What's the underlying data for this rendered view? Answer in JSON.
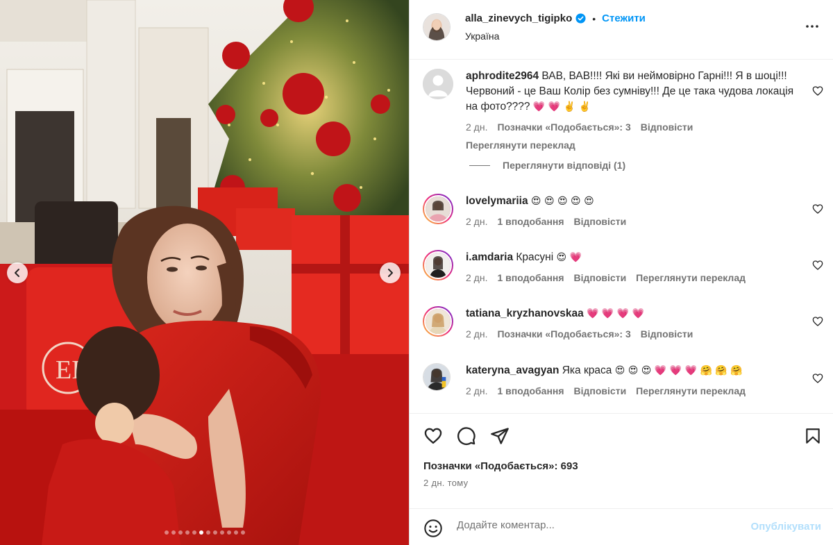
{
  "post": {
    "username": "alla_zinevych_tigipko",
    "follow_label": "Стежити",
    "separator": "•",
    "location": "Україна",
    "more_label": "•••"
  },
  "carousel": {
    "dots_total": 12,
    "active_dot_index": 5
  },
  "comments": [
    {
      "username": "aphrodite2964",
      "text": "ВАВ, ВАВ!!!! Які ви неймовірно Гарні!!! Я в шоці!!! Червоний - це Ваш Колір без сумніву!!! Де це така чудова локація на фото????",
      "emojis": "💗 💗 ✌️ ✌️",
      "time": "2 дн.",
      "likes": "Позначки «Подобається»: 3",
      "reply": "Відповісти",
      "translate": "Переглянути переклад",
      "view_replies": "Переглянути відповіді (1)"
    },
    {
      "username": "lovelymariia",
      "text": "",
      "emojis": "😍 😍 😍 😍 😍",
      "time": "2 дн.",
      "likes": "1 вподобання",
      "reply": "Відповісти",
      "translate": ""
    },
    {
      "username": "i.amdaria",
      "text": "Красуні",
      "emojis": "😍 💗",
      "time": "2 дн.",
      "likes": "1 вподобання",
      "reply": "Відповісти",
      "translate": "Переглянути переклад"
    },
    {
      "username": "tatiana_kryzhanovskaa",
      "text": "",
      "emojis": "💗 💗 💗 💗",
      "time": "2 дн.",
      "likes": "Позначки «Подобається»: 3",
      "reply": "Відповісти",
      "translate": ""
    },
    {
      "username": "kateryna_avagyan",
      "text": "Яка краса",
      "emojis": "😍 😍 😍 💗 💗 💗 🤗 🤗 🤗",
      "time": "2 дн.",
      "likes": "1 вподобання",
      "reply": "Відповісти",
      "translate": "Переглянути переклад"
    }
  ],
  "stats": {
    "likes_text": "Позначки «Подобається»: 693",
    "time_ago": "2 дн. тому"
  },
  "composer": {
    "placeholder": "Додайте коментар...",
    "post_label": "Опублікувати"
  },
  "colors": {
    "accent": "#0095f6",
    "muted": "#737373",
    "post_disabled": "#b2dffc",
    "verified": "#0095f6"
  }
}
